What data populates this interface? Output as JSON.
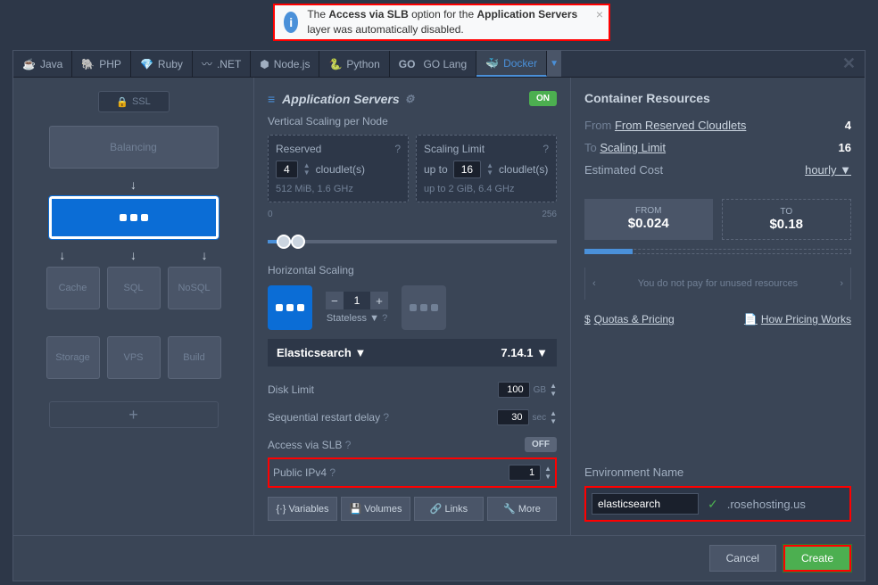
{
  "notification": {
    "text_pre": "The ",
    "bold1": "Access via SLB",
    "text_mid": " option for the ",
    "bold2": "Application Servers",
    "text_post": " layer was automatically disabled."
  },
  "tabs": {
    "java": "Java",
    "php": "PHP",
    "ruby": "Ruby",
    "dotnet": ".NET",
    "nodejs": "Node.js",
    "python": "Python",
    "go": "GO Lang",
    "docker": "Docker"
  },
  "left": {
    "ssl": "SSL",
    "balancing": "Balancing",
    "cache": "Cache",
    "sql": "SQL",
    "nosql": "NoSQL",
    "storage": "Storage",
    "vps": "VPS",
    "build": "Build"
  },
  "middle": {
    "title": "Application Servers",
    "on": "ON",
    "vscale_label": "Vertical Scaling per Node",
    "reserved": {
      "label": "Reserved",
      "value": "4",
      "unit": "cloudlet(s)",
      "sub": "512 MiB, 1.6 GHz"
    },
    "limit": {
      "label": "Scaling Limit",
      "prefix": "up to",
      "value": "16",
      "unit": "cloudlet(s)",
      "sub": "up to 2 GiB, 6.4 GHz"
    },
    "slider_min": "0",
    "slider_max": "256",
    "hscale_label": "Horizontal Scaling",
    "hscale_value": "1",
    "hscale_mode": "Stateless",
    "tech": "Elasticsearch",
    "version": "7.14.1",
    "disk_label": "Disk Limit",
    "disk_value": "100",
    "disk_unit": "GB",
    "restart_label": "Sequential restart delay",
    "restart_value": "30",
    "restart_unit": "sec",
    "slb_label": "Access via SLB",
    "slb_off": "OFF",
    "ipv4_label": "Public IPv4",
    "ipv4_value": "1",
    "actions": {
      "variables": "Variables",
      "volumes": "Volumes",
      "links": "Links",
      "more": "More"
    }
  },
  "right": {
    "title": "Container Resources",
    "reserved_label": "From Reserved Cloudlets",
    "reserved_val": "4",
    "limit_label": "To Scaling Limit",
    "limit_val": "16",
    "cost_label": "Estimated Cost",
    "cost_period": "hourly",
    "from_label": "FROM",
    "from_price": "$0.024",
    "to_label": "TO",
    "to_price": "$0.18",
    "note": "You do not pay for unused resources",
    "quotas": "Quotas & Pricing",
    "howpricing": "How Pricing Works",
    "env_label": "Environment Name",
    "env_value": "elasticsearch",
    "env_domain": ".rosehosting.us"
  },
  "footer": {
    "cancel": "Cancel",
    "create": "Create"
  }
}
